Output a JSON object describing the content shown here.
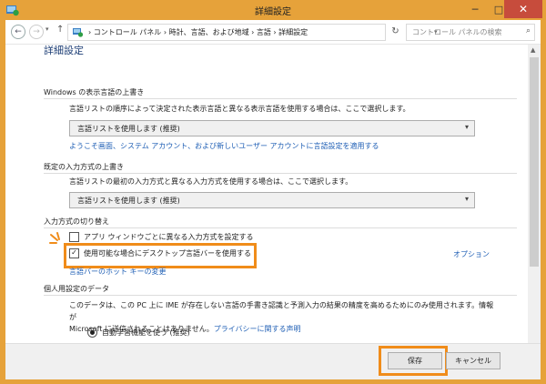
{
  "window": {
    "title": "詳細設定",
    "minimize_glyph": "─",
    "maximize_glyph": "□",
    "close_glyph": "✕"
  },
  "nav": {
    "back_glyph": "←",
    "forward_glyph": "→",
    "history_glyph": "▾",
    "up_glyph": "↑",
    "breadcrumb": "› コントロール パネル › 時計、言語、および地域 › 言語 › 詳細設定",
    "address_dropdown_glyph": "▾",
    "refresh_glyph": "↻",
    "search_placeholder": "コントロール パネルの検索",
    "search_glyph": "⌕"
  },
  "page": {
    "heading": "詳細設定",
    "display_lang": {
      "section_title": "Windows の表示言語の上書き",
      "description": "言語リストの順序によって決定された表示言語と異なる表示言語を使用する場合は、ここで選択します。",
      "dropdown_value": "言語リストを使用します (推奨)",
      "apply_link": "ようこそ画面、システム アカウント、および新しいユーザー アカウントに言語設定を適用する"
    },
    "input_method": {
      "section_title": "既定の入力方式の上書き",
      "description": "言語リストの最初の入力方式と異なる入力方式を使用する場合は、ここで選択します。",
      "dropdown_value": "言語リストを使用します (推奨)"
    },
    "switching": {
      "section_title": "入力方式の切り替え",
      "checkbox1_label": "アプリ ウィンドウごとに異なる入力方式を設定する",
      "checkbox1_checked": false,
      "checkbox2_label": "使用可能な場合にデスクトップ言語バーを使用する",
      "checkbox2_checked": true,
      "options_link": "オプション",
      "hotkey_link": "言語バーのホット キーの変更"
    },
    "personalization": {
      "section_title": "個人用設定のデータ",
      "paragraph_line1": "このデータは、この PC 上に IME が存在しない言語の手書き認識と予測入力の結果の精度を高めるためにのみ使用されます。情報が",
      "paragraph_line2_prefix": "Microsoft に送信されることはありません。",
      "privacy_link": "プライバシーに関する声明",
      "radio1_label": "自動学習機能を使う (推奨)",
      "radio1_selected": true
    }
  },
  "footer": {
    "save_label": "保存",
    "cancel_label": "キャンセル"
  },
  "colors": {
    "title_bar": "#e6a23a",
    "close_button": "#c74c3c",
    "highlight_outline": "#f08c1a",
    "link": "#1f5fb5",
    "heading": "#1e3f76"
  }
}
